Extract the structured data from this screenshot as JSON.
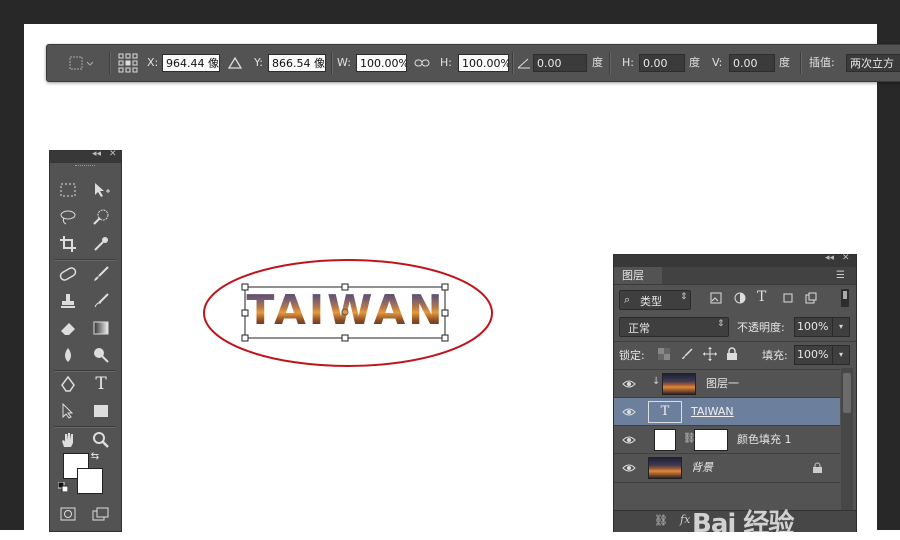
{
  "options_bar": {
    "x_label": "X:",
    "x_value": "964.44 像!",
    "delta_icon": "delta-icon",
    "y_label": "Y:",
    "y_value": "866.54 像!",
    "w_label": "W:",
    "w_value": "100.00%",
    "h_label": "H:",
    "h_value": "100.00%",
    "angle_value": "0.00",
    "angle_unit": "度",
    "hskew_label": "H:",
    "hskew_value": "0.00",
    "hskew_unit": "度",
    "vskew_label": "V:",
    "vskew_value": "0.00",
    "vskew_unit": "度",
    "interp_label": "插值:",
    "interp_value": "两次立方"
  },
  "canvas": {
    "text_layer_content": "TAIWAN",
    "highlight_color": "#c0141c"
  },
  "tools": {
    "items": [
      "marquee-tool",
      "move-tool",
      "lasso-tool",
      "quick-select-tool",
      "crop-tool",
      "eyedropper-tool",
      "healing-brush-tool",
      "brush-tool",
      "clone-stamp-tool",
      "history-brush-tool",
      "eraser-tool",
      "gradient-tool",
      "blur-tool",
      "dodge-tool",
      "pen-tool",
      "type-tool",
      "path-select-tool",
      "rectangle-tool",
      "hand-tool",
      "zoom-tool"
    ],
    "type_glyph": "T"
  },
  "layers_panel": {
    "tab_label": "图层",
    "filter_label": "类型",
    "blend_mode": "正常",
    "opacity_label": "不透明度:",
    "opacity_value": "100%",
    "lock_label": "锁定:",
    "fill_label": "填充:",
    "fill_value": "100%",
    "layers": [
      {
        "name": "图层一",
        "type": "image",
        "selected": false
      },
      {
        "name": "TAIWAN",
        "type": "text",
        "selected": true
      },
      {
        "name": "颜色填充 1",
        "type": "fill",
        "selected": false
      },
      {
        "name": "背景",
        "type": "background",
        "selected": false
      }
    ],
    "fx_label": "fx"
  },
  "watermark": "Bai 经验"
}
